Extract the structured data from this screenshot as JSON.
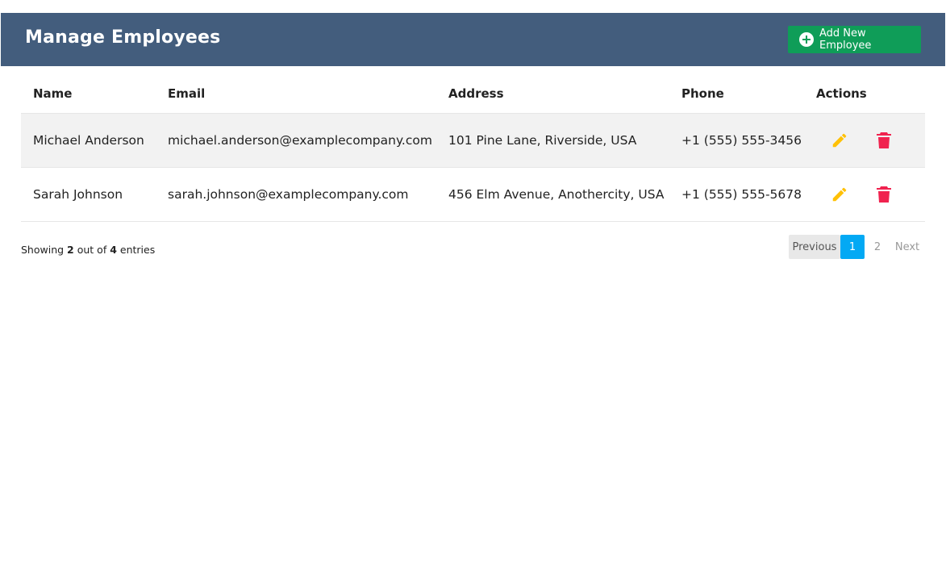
{
  "header": {
    "title": "Manage Employees",
    "add_button_label": "Add New Employee"
  },
  "table": {
    "columns": [
      "Name",
      "Email",
      "Address",
      "Phone",
      "Actions"
    ],
    "rows": [
      {
        "name": "Michael Anderson",
        "email": "michael.anderson@examplecompany.com",
        "address": "101 Pine Lane, Riverside, USA",
        "phone": "+1 (555) 555-3456"
      },
      {
        "name": "Sarah Johnson",
        "email": "sarah.johnson@examplecompany.com",
        "address": "456 Elm Avenue, Anothercity, USA",
        "phone": "+1 (555) 555-5678"
      }
    ]
  },
  "footer": {
    "showing_prefix": "Showing",
    "shown": "2",
    "out_of": "out of",
    "total": "4",
    "entries": "entries"
  },
  "pagination": {
    "previous": "Previous",
    "pages": [
      "1",
      "2"
    ],
    "next": "Next",
    "active_page": "1"
  },
  "icons": {
    "add": "plus-circle-icon",
    "edit": "pencil-icon",
    "delete": "trash-icon"
  },
  "colors": {
    "header_bg": "#435d7d",
    "add_button": "#0f9d58",
    "edit_icon": "#ffc107",
    "delete_icon": "#f44336",
    "active_page": "#03a9f4",
    "striped_row": "#f2f2f2"
  }
}
